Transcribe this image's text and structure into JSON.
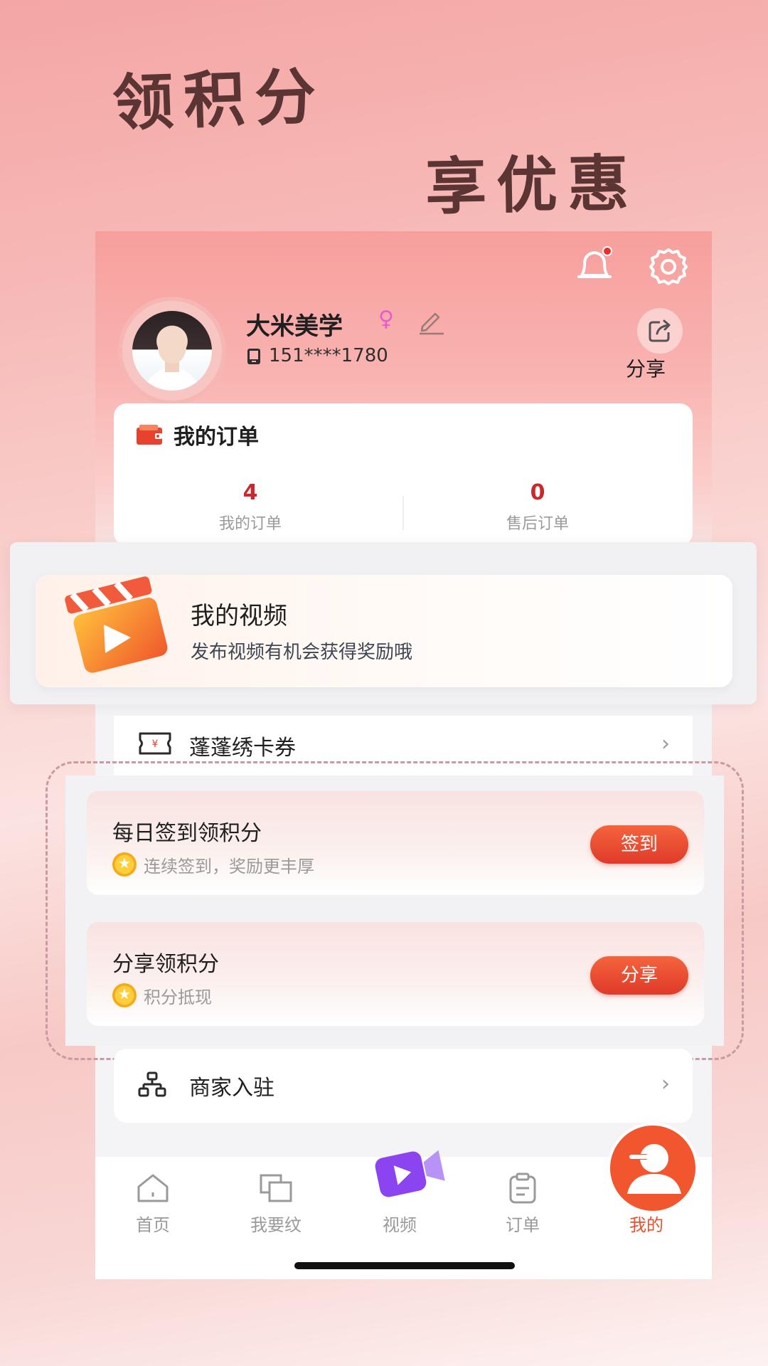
{
  "promo": {
    "line1": "领积分",
    "line2": "享优惠"
  },
  "header": {
    "bell_icon": "bell-icon",
    "settings_icon": "gear-icon",
    "username": "大米美学",
    "gender_symbol": "♀",
    "phone": "151****1780",
    "share_label": "分享"
  },
  "orders": {
    "title": "我的订单",
    "stats": [
      {
        "value": "4",
        "label": "我的订单"
      },
      {
        "value": "0",
        "label": "售后订单"
      }
    ]
  },
  "video": {
    "title": "我的视频",
    "subtitle": "发布视频有机会获得奖励哦"
  },
  "coupon": {
    "label": "蓬蓬绣卡券"
  },
  "tasks": [
    {
      "title": "每日签到领积分",
      "subtitle": "连续签到，奖励更丰厚",
      "button": "签到"
    },
    {
      "title": "分享领积分",
      "subtitle": "积分抵现",
      "button": "分享"
    }
  ],
  "merchant": {
    "label": "商家入驻"
  },
  "chevron": "›",
  "tabbar": {
    "items": [
      {
        "label": "首页",
        "icon": "home-icon"
      },
      {
        "label": "我要纹",
        "icon": "layers-icon"
      },
      {
        "label": "视频",
        "icon": "video-camera-icon"
      },
      {
        "label": "订单",
        "icon": "clipboard-icon"
      },
      {
        "label": "我的",
        "icon": "user-icon",
        "active": true
      }
    ]
  },
  "colors": {
    "accent": "#e8502f",
    "order_number": "#c9282c",
    "headline": "#5a3533"
  }
}
